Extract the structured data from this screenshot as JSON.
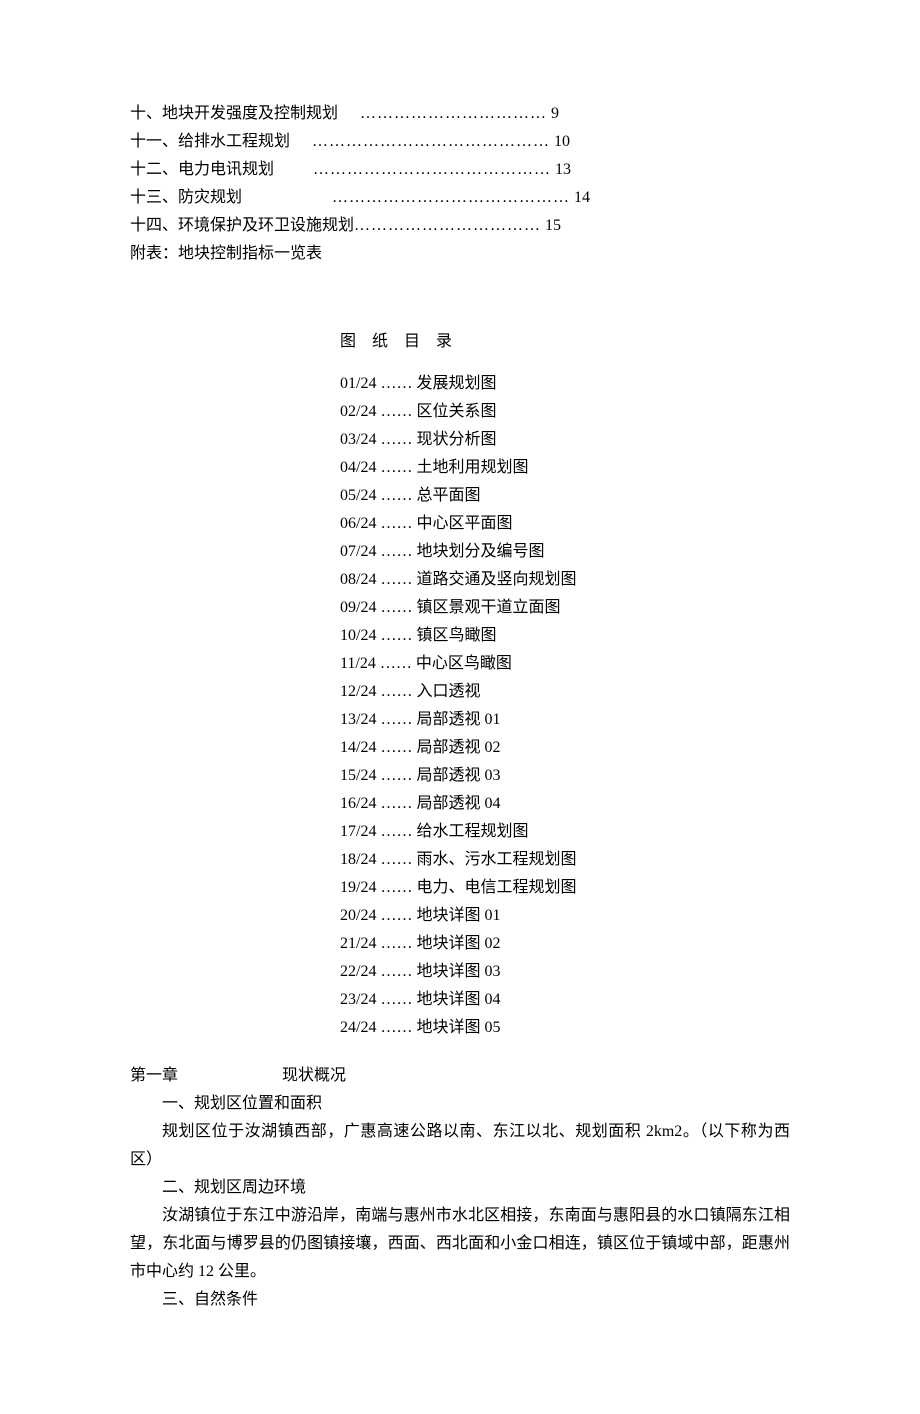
{
  "toc_top": [
    {
      "label": "十、地块开发强度及控制规划",
      "dots": "　 ……………………………",
      "page": "9"
    },
    {
      "label": "十一、给排水工程规划",
      "dots": "　 ……………………………………",
      "page": "10"
    },
    {
      "label": "十二、电力电讯规划",
      "dots": "　　 ……………………………………",
      "page": "13"
    },
    {
      "label": "十三、防灾规划",
      "dots": "　　　　　 ……………………………………",
      "page": "14"
    },
    {
      "label": "十四、环境保护及环卫设施规划",
      "dots": "……………………………",
      "page": "15"
    },
    {
      "label": "附表：地块控制指标一览表",
      "dots": "",
      "page": ""
    }
  ],
  "figure_title": "图 纸 目 录",
  "figures": [
    {
      "num": "01/24",
      "sep": " …… ",
      "name": "发展规划图"
    },
    {
      "num": "02/24",
      "sep": " …… ",
      "name": "区位关系图"
    },
    {
      "num": "03/24",
      "sep": " …… ",
      "name": "现状分析图"
    },
    {
      "num": "04/24",
      "sep": " …… ",
      "name": "土地利用规划图"
    },
    {
      "num": "05/24",
      "sep": " …… ",
      "name": "总平面图"
    },
    {
      "num": "06/24",
      "sep": " …… ",
      "name": "中心区平面图"
    },
    {
      "num": "07/24",
      "sep": " …… ",
      "name": "地块划分及编号图"
    },
    {
      "num": "08/24",
      "sep": " …… ",
      "name": "道路交通及竖向规划图"
    },
    {
      "num": "09/24",
      "sep": " …… ",
      "name": "镇区景观干道立面图"
    },
    {
      "num": "10/24",
      "sep": " …… ",
      "name": "镇区鸟瞰图"
    },
    {
      "num": "11/24",
      "sep": " …… ",
      "name": "中心区鸟瞰图"
    },
    {
      "num": "12/24",
      "sep": " …… ",
      "name": "入口透视"
    },
    {
      "num": "13/24",
      "sep": " …… ",
      "name": "局部透视 01"
    },
    {
      "num": "14/24",
      "sep": " …… ",
      "name": "局部透视 02"
    },
    {
      "num": "15/24",
      "sep": " …… ",
      "name": "局部透视 03"
    },
    {
      "num": "16/24",
      "sep": " …… ",
      "name": "局部透视 04"
    },
    {
      "num": "17/24",
      "sep": " …… ",
      "name": "给水工程规划图"
    },
    {
      "num": "18/24",
      "sep": " …… ",
      "name": "雨水、污水工程规划图"
    },
    {
      "num": "19/24",
      "sep": " …… ",
      "name": "电力、电信工程规划图"
    },
    {
      "num": "20/24",
      "sep": " …… ",
      "name": "地块详图 01"
    },
    {
      "num": "21/24",
      "sep": " …… ",
      "name": "地块详图 02"
    },
    {
      "num": "22/24",
      "sep": " …… ",
      "name": "地块详图 03"
    },
    {
      "num": "23/24",
      "sep": " …… ",
      "name": "地块详图 04"
    },
    {
      "num": "24/24",
      "sep": " …… ",
      "name": "地块详图 05"
    }
  ],
  "chapter_label": "第一章",
  "chapter_title": "现状概况",
  "body": {
    "h1": "一、规划区位置和面积",
    "p1": "规划区位于汝湖镇西部，广惠高速公路以南、东江以北、规划面积 2km2。（以下称为西区）",
    "h2": "二、规划区周边环境",
    "p2": "汝湖镇位于东江中游沿岸，南端与惠州市水北区相接，东南面与惠阳县的水口镇隔东江相望，东北面与博罗县的仍图镇接壤，西面、西北面和小金口相连，镇区位于镇域中部，距惠州市中心约 12 公里。",
    "h3": "三、自然条件"
  }
}
